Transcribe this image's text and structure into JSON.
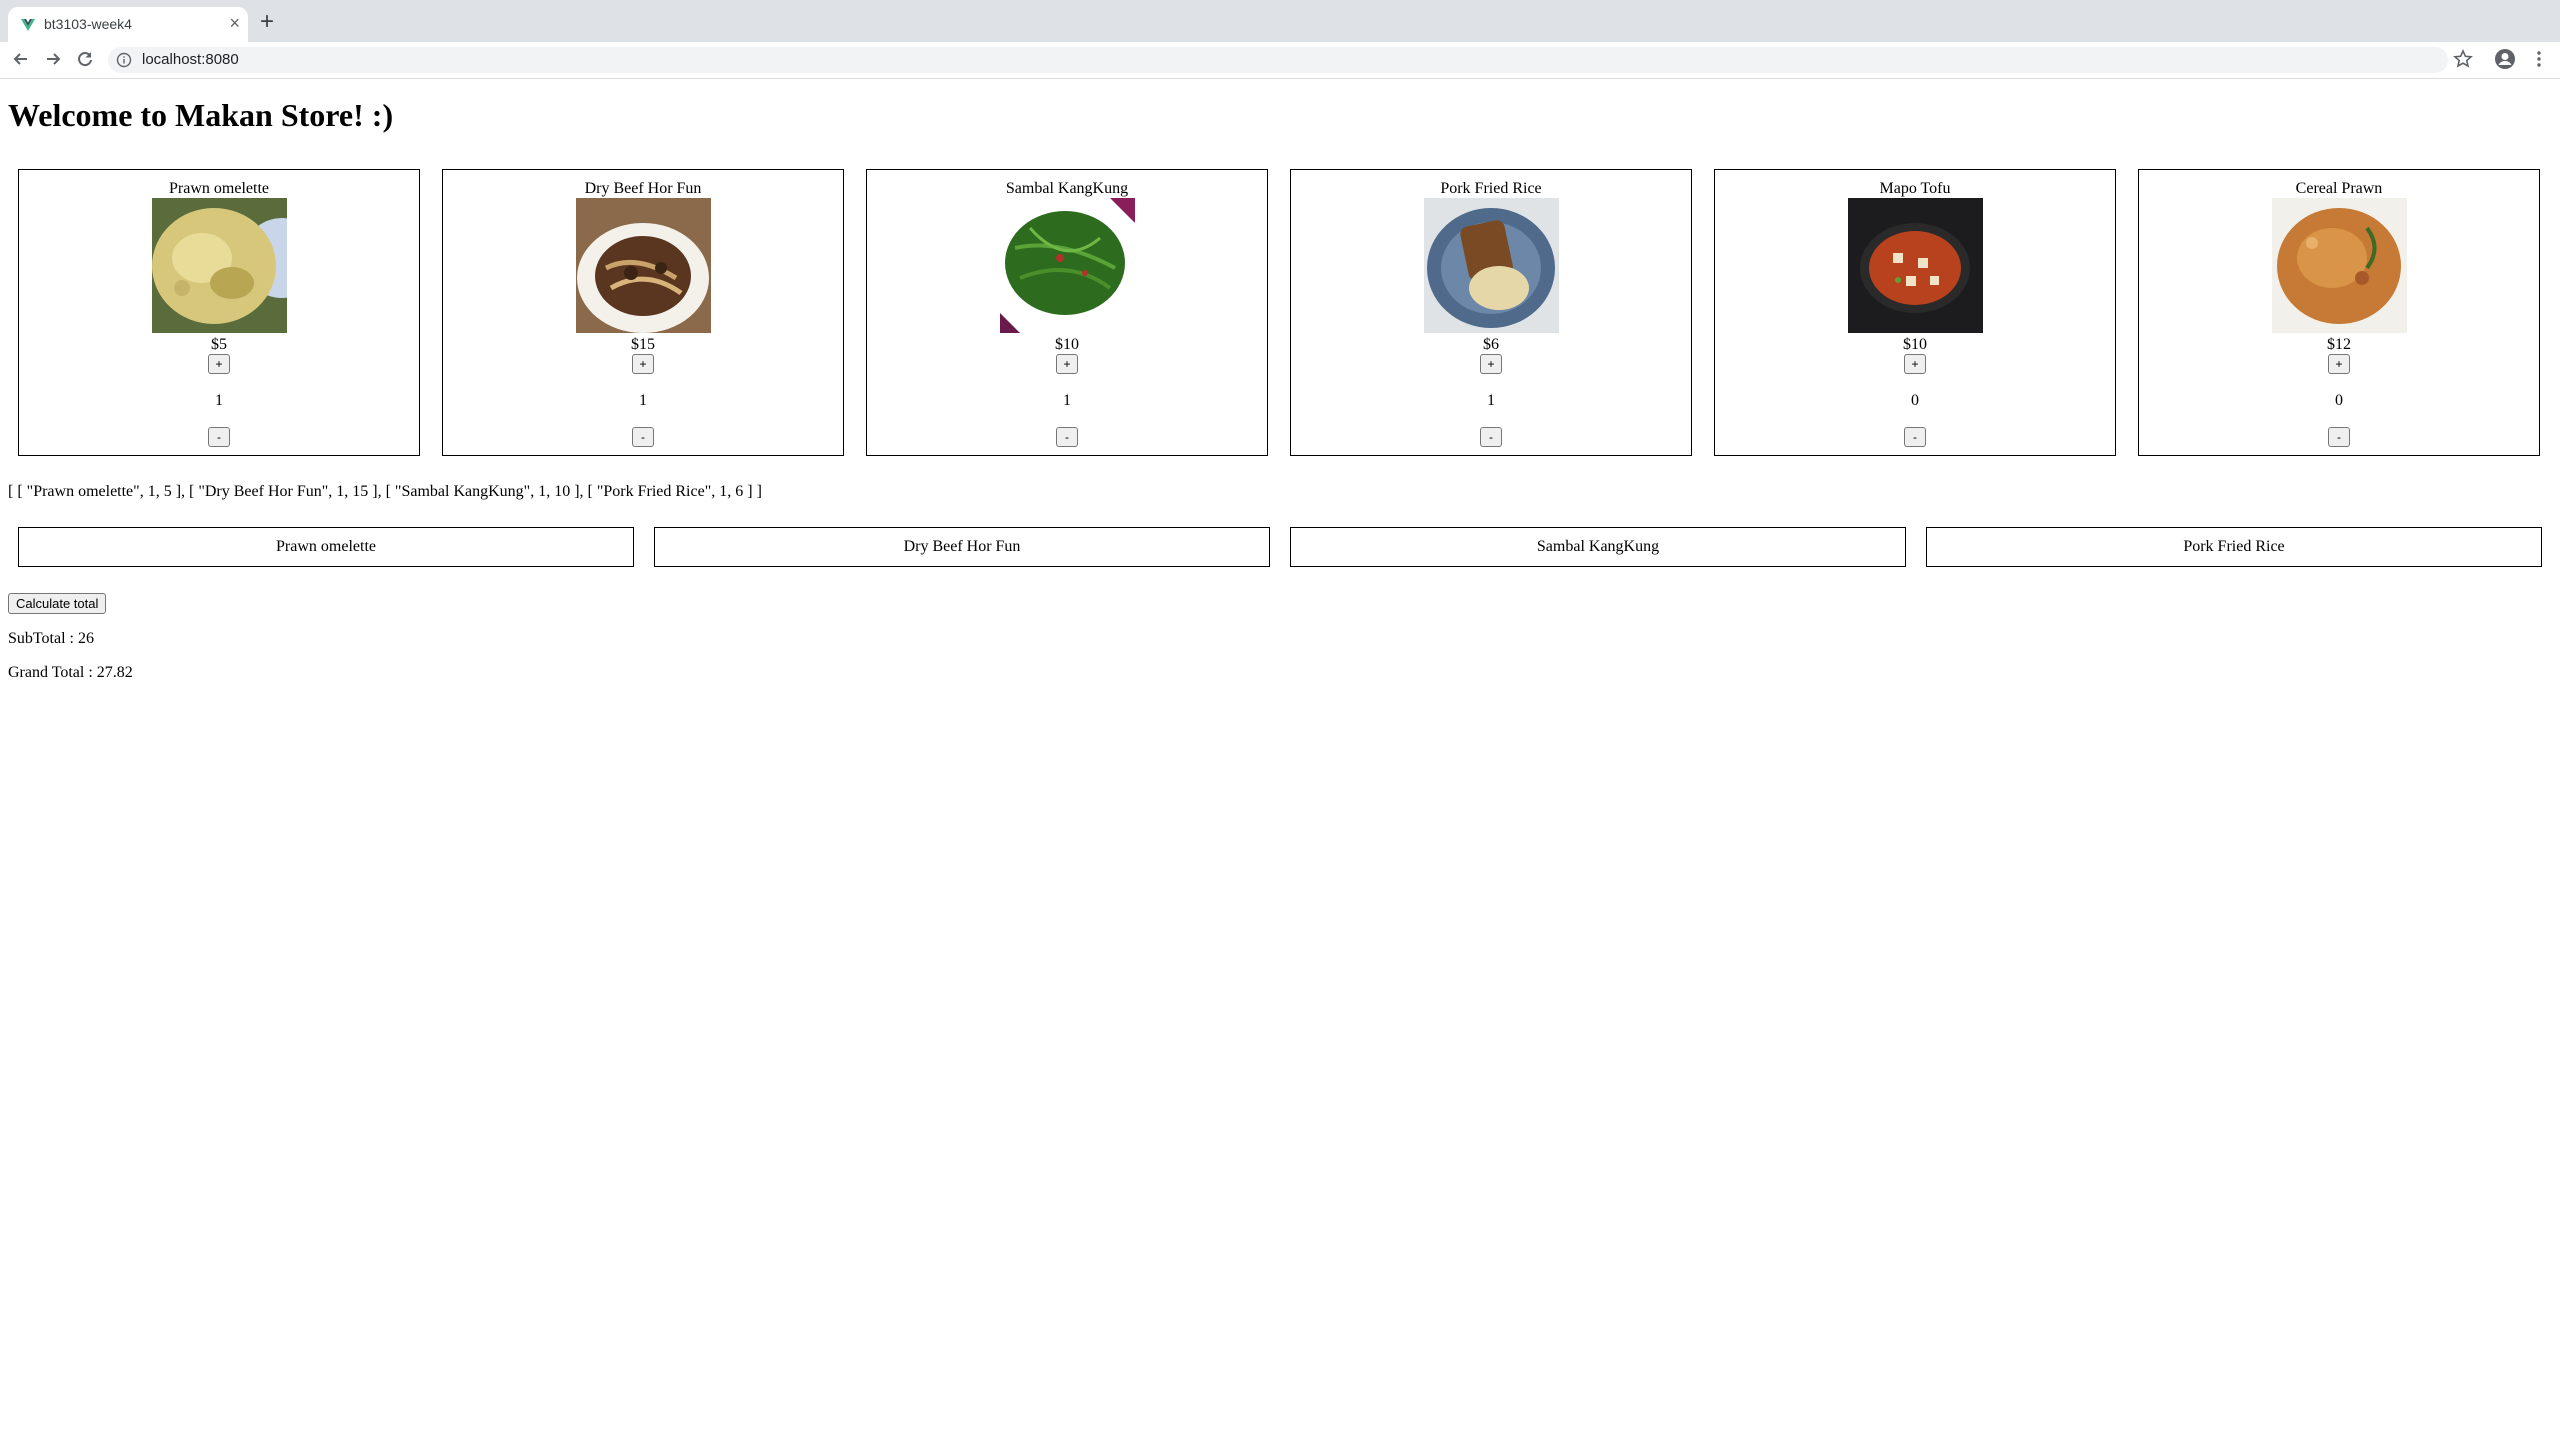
{
  "browser": {
    "tab_title": "bt3103-week4",
    "new_tab_label": "+",
    "close_label": "×",
    "url": "localhost:8080"
  },
  "page": {
    "title": "Welcome to Makan Store! :)"
  },
  "products": [
    {
      "name": "Prawn omelette",
      "price": "$5",
      "qty": "1",
      "plus": "+",
      "minus": "-"
    },
    {
      "name": "Dry Beef Hor Fun",
      "price": "$15",
      "qty": "1",
      "plus": "+",
      "minus": "-"
    },
    {
      "name": "Sambal KangKung",
      "price": "$10",
      "qty": "1",
      "plus": "+",
      "minus": "-"
    },
    {
      "name": "Pork Fried Rice",
      "price": "$6",
      "qty": "1",
      "plus": "+",
      "minus": "-"
    },
    {
      "name": "Mapo Tofu",
      "price": "$10",
      "qty": "0",
      "plus": "+",
      "minus": "-"
    },
    {
      "name": "Cereal Prawn",
      "price": "$12",
      "qty": "0",
      "plus": "+",
      "minus": "-"
    }
  ],
  "cart": {
    "array_text": "[ [ \"Prawn omelette\", 1, 5 ], [ \"Dry Beef Hor Fun\", 1, 15 ], [ \"Sambal KangKung\", 1, 10 ], [ \"Pork Fried Rice\", 1, 6 ] ]",
    "items": [
      "Prawn omelette",
      "Dry Beef Hor Fun",
      "Sambal KangKung",
      "Pork Fried Rice"
    ]
  },
  "totals": {
    "calculate_label": "Calculate total",
    "subtotal_text": "SubTotal : 26",
    "grandtotal_text": "Grand Total : 27.82"
  }
}
